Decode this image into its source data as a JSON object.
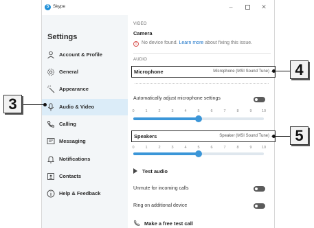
{
  "window": {
    "app_title": "Skype",
    "app_logo_letter": "S",
    "controls": {
      "minimize": "–",
      "close": "✕"
    }
  },
  "sidebar": {
    "title": "Settings",
    "items": [
      {
        "label": "Account & Profile",
        "icon": "person-icon"
      },
      {
        "label": "General",
        "icon": "gear-icon"
      },
      {
        "label": "Appearance",
        "icon": "wand-icon"
      },
      {
        "label": "Audio & Video",
        "icon": "microphone-icon",
        "active": true
      },
      {
        "label": "Calling",
        "icon": "phone-icon"
      },
      {
        "label": "Messaging",
        "icon": "message-icon"
      },
      {
        "label": "Notifications",
        "icon": "bell-icon"
      },
      {
        "label": "Contacts",
        "icon": "contacts-icon"
      },
      {
        "label": "Help & Feedback",
        "icon": "info-icon"
      }
    ]
  },
  "video": {
    "section_label": "VIDEO",
    "camera_label": "Camera",
    "warning_prefix": "No device found.",
    "warning_link": "Learn more",
    "warning_suffix": "about fixing this issue."
  },
  "audio": {
    "section_label": "AUDIO",
    "microphone_label": "Microphone",
    "microphone_device": "Microphone (MSI Sound Tune)",
    "auto_adjust_label": "Automatically adjust microphone settings",
    "auto_adjust_on": true,
    "mic_level": 5,
    "speakers_label": "Speakers",
    "speakers_device": "Speaker (MSI Sound Tune)",
    "speaker_level": 5,
    "scale": [
      "0",
      "1",
      "2",
      "3",
      "4",
      "5",
      "6",
      "7",
      "8",
      "9",
      "10"
    ],
    "test_audio_label": "Test audio",
    "unmute_label": "Unmute for incoming calls",
    "unmute_on": true,
    "ring_label": "Ring on additional device",
    "ring_on": true,
    "free_call_label": "Make a free test call"
  },
  "callouts": {
    "three": "3",
    "four": "4",
    "five": "5"
  },
  "colors": {
    "accent": "#3b96d8",
    "active_nav": "#dbecf8",
    "sidebar_bg": "#f3f6f8",
    "warning": "#d9534f",
    "link": "#1a73c8"
  }
}
